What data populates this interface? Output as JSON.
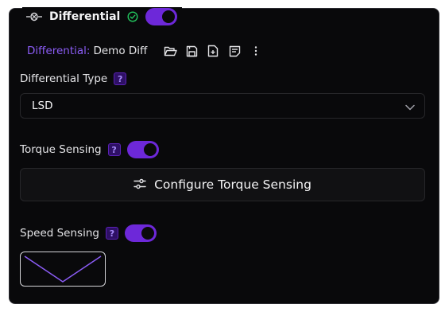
{
  "colors": {
    "accent": "#7c3aed",
    "accent_text": "#8b5cf6",
    "success": "#22c55e",
    "background": "#09090b",
    "border": "#27272a"
  },
  "section": {
    "title": "Differential",
    "enabled": true,
    "icon": "differential-icon",
    "status_icon": "check-circle-icon"
  },
  "toolbar": {
    "prefix": "Differential:",
    "name": "Demo Diff",
    "icons": [
      "folder-open-icon",
      "save-icon",
      "file-plus-icon",
      "notes-icon",
      "more-vertical-icon"
    ]
  },
  "differential_type": {
    "label": "Differential Type",
    "help": "?",
    "value": "LSD"
  },
  "torque_sensing": {
    "label": "Torque Sensing",
    "help": "?",
    "enabled": true,
    "button_label": "Configure Torque Sensing"
  },
  "speed_sensing": {
    "label": "Speed Sensing",
    "help": "?",
    "enabled": true,
    "preview_icon": "curve-preview"
  }
}
